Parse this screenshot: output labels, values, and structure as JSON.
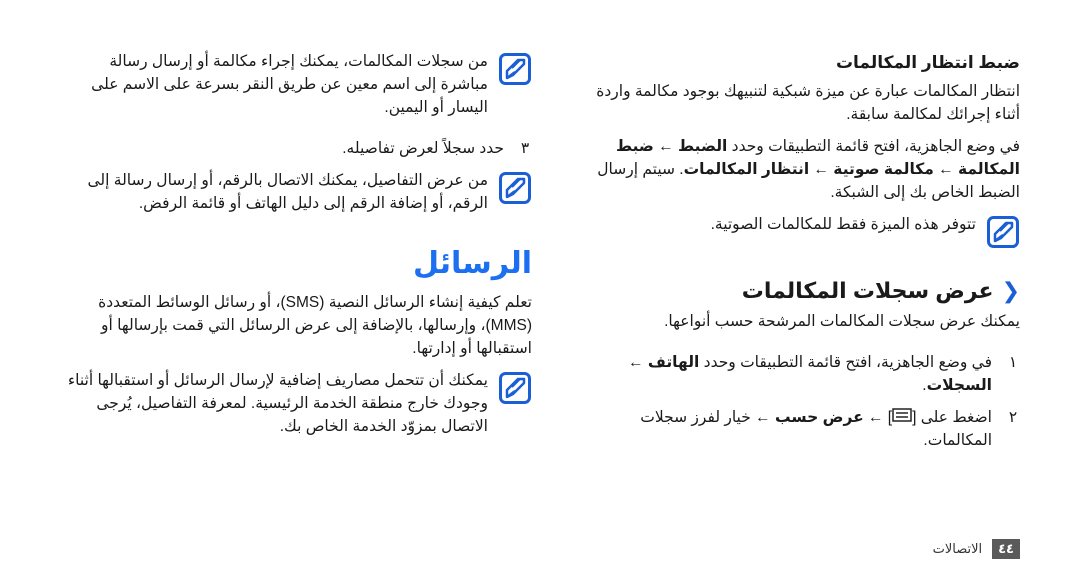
{
  "right_column": {
    "call_waiting": {
      "title": "ضبط انتظار المكالمات",
      "description": "انتظار المكالمات عبارة عن ميزة شبكية لتنبيهك بوجود مكالمة واردة أثناء إجرائك لمكالمة سابقة.",
      "instruction_parts": [
        {
          "text": "في وضع الجاهزية، افتح قائمة التطبيقات وحدد ",
          "bold": false
        },
        {
          "text": "الضبط",
          "bold": true
        },
        {
          "text": " ← ",
          "bold": false
        },
        {
          "text": "ضبط المكالمة",
          "bold": true
        },
        {
          "text": " ← ",
          "bold": false
        },
        {
          "text": "مكالمة صوتية",
          "bold": true
        },
        {
          "text": " ← ",
          "bold": false
        },
        {
          "text": "انتظار المكالمات",
          "bold": true
        },
        {
          "text": ". سيتم إرسال الضبط الخاص بك إلى الشبكة.",
          "bold": false
        }
      ],
      "note": "تتوفر هذه الميزة فقط للمكالمات الصوتية."
    },
    "view_call_logs": {
      "title": "عرض سجلات المكالمات",
      "description": "يمكنك عرض سجلات المكالمات المرشحة حسب أنواعها.",
      "steps": [
        {
          "number": "١",
          "parts": [
            {
              "text": "في وضع الجاهزية، افتح قائمة التطبيقات وحدد ",
              "bold": false
            },
            {
              "text": "الهاتف",
              "bold": true
            },
            {
              "text": " ← ",
              "bold": false
            },
            {
              "text": "السجلات",
              "bold": true
            },
            {
              "text": ".",
              "bold": false
            }
          ]
        },
        {
          "number": "٢",
          "parts": [
            {
              "text": "اضغط على [",
              "bold": false
            },
            {
              "icon": "menu-key-icon"
            },
            {
              "text": "] ← ",
              "bold": false
            },
            {
              "text": "عرض حسب",
              "bold": true
            },
            {
              "text": " ← خيار لفرز سجلات المكالمات.",
              "bold": false
            }
          ]
        }
      ]
    }
  },
  "left_column": {
    "note_quick_action": "من سجلات المكالمات، يمكنك إجراء مكالمة أو إرسال رسالة مباشرة إلى اسم معين عن طريق النقر بسرعة على الاسم على اليسار أو اليمين.",
    "step3": {
      "number": "٣",
      "text": "حدد سجلاً لعرض تفاصيله."
    },
    "note_details": "من عرض التفاصيل، يمكنك الاتصال بالرقم، أو إرسال رسالة إلى الرقم، أو إضافة الرقم إلى دليل الهاتف أو قائمة الرفض.",
    "messages": {
      "chapter_title": "الرسائل",
      "intro": "تعلم كيفية إنشاء الرسائل النصية (SMS)، أو رسائل الوسائط المتعددة (MMS)، وإرسالها، بالإضافة إلى عرض الرسائل التي قمت بإرسالها أو استقبالها أو إدارتها.",
      "note_roaming": "يمكنك أن تتحمل مصاريف إضافية لإرسال الرسائل أو استقبالها أثناء وجودك خارج منطقة الخدمة الرئيسية. لمعرفة التفاصيل، يُرجى الاتصال بمزوّد الخدمة الخاص بك."
    }
  },
  "footer": {
    "page_number": "٤٤",
    "section_label": "الاتصالات"
  },
  "colors": {
    "accent_blue": "#1d6ff2",
    "note_icon_blue": "#1a5fd6",
    "page_box": "#5a5a5a"
  }
}
